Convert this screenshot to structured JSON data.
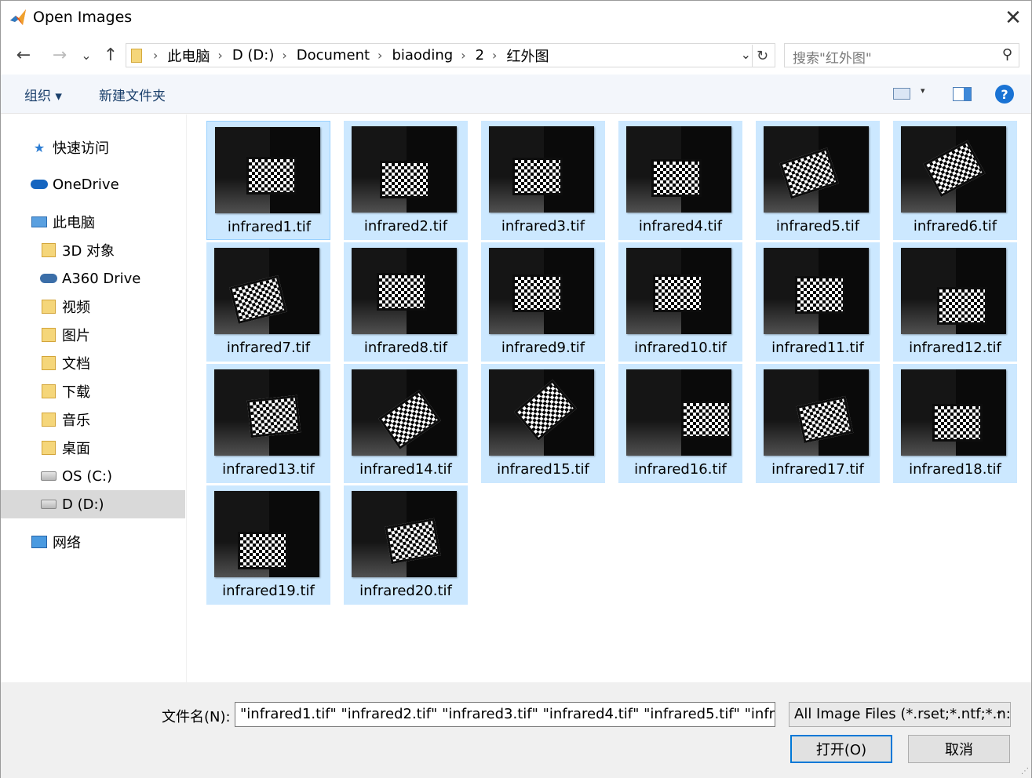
{
  "window": {
    "title": "Open Images",
    "close_glyph": "✕"
  },
  "nav": {
    "back_glyph": "←",
    "forward_glyph": "→",
    "recent_glyph": "⌄",
    "up_glyph": "↑",
    "breadcrumbs": [
      "此电脑",
      "D (D:)",
      "Document",
      "biaoding",
      "2",
      "红外图"
    ],
    "crumb_separator": "›",
    "dropdown_glyph": "⌄",
    "refresh_glyph": "↻",
    "search_placeholder": "搜索\"红外图\"",
    "search_glyph": "⚲"
  },
  "toolbar": {
    "organize_label": "组织 ▾",
    "new_folder_label": "新建文件夹",
    "view_caret": "▾",
    "help_glyph": "?"
  },
  "sidebar": {
    "items": [
      {
        "label": "快速访问",
        "icon": "star-icon",
        "glyph": "★",
        "indent": 1
      },
      {
        "label": "OneDrive",
        "icon": "cloud-icon",
        "glyph": "",
        "indent": 1
      },
      {
        "label": "此电脑",
        "icon": "computer-icon",
        "glyph": "",
        "indent": 1
      },
      {
        "label": "3D 对象",
        "icon": "folder-icon",
        "glyph": "",
        "indent": 2
      },
      {
        "label": "A360 Drive",
        "icon": "a360-icon",
        "glyph": "",
        "indent": 2
      },
      {
        "label": "视频",
        "icon": "video-folder-icon",
        "glyph": "",
        "indent": 2
      },
      {
        "label": "图片",
        "icon": "pictures-folder-icon",
        "glyph": "",
        "indent": 2
      },
      {
        "label": "文档",
        "icon": "documents-folder-icon",
        "glyph": "",
        "indent": 2
      },
      {
        "label": "下载",
        "icon": "download-folder-icon",
        "glyph": "",
        "indent": 2
      },
      {
        "label": "音乐",
        "icon": "music-folder-icon",
        "glyph": "",
        "indent": 2
      },
      {
        "label": "桌面",
        "icon": "desktop-folder-icon",
        "glyph": "",
        "indent": 2
      },
      {
        "label": "OS (C:)",
        "icon": "drive-icon",
        "glyph": "",
        "indent": 2
      },
      {
        "label": "D (D:)",
        "icon": "drive-icon",
        "glyph": "",
        "indent": 2,
        "selected": true
      },
      {
        "label": "网络",
        "icon": "network-icon",
        "glyph": "",
        "indent": 1
      }
    ]
  },
  "files": [
    "infrared1.tif",
    "infrared2.tif",
    "infrared3.tif",
    "infrared4.tif",
    "infrared5.tif",
    "infrared6.tif",
    "infrared7.tif",
    "infrared8.tif",
    "infrared9.tif",
    "infrared10.tif",
    "infrared11.tif",
    "infrared12.tif",
    "infrared13.tif",
    "infrared14.tif",
    "infrared15.tif",
    "infrared16.tif",
    "infrared17.tif",
    "infrared18.tif",
    "infrared19.tif",
    "infrared20.tif"
  ],
  "footer": {
    "filename_label": "文件名(N):",
    "filename_value": "\"infrared1.tif\" \"infrared2.tif\" \"infrared3.tif\" \"infrared4.tif\" \"infrared5.tif\" \"infra",
    "filetype_value": "All Image Files (*.rset;*.ntf;*.n:",
    "filetype_dropdown_glyph": "⌄",
    "open_label": "打开(O)",
    "cancel_label": "取消"
  }
}
